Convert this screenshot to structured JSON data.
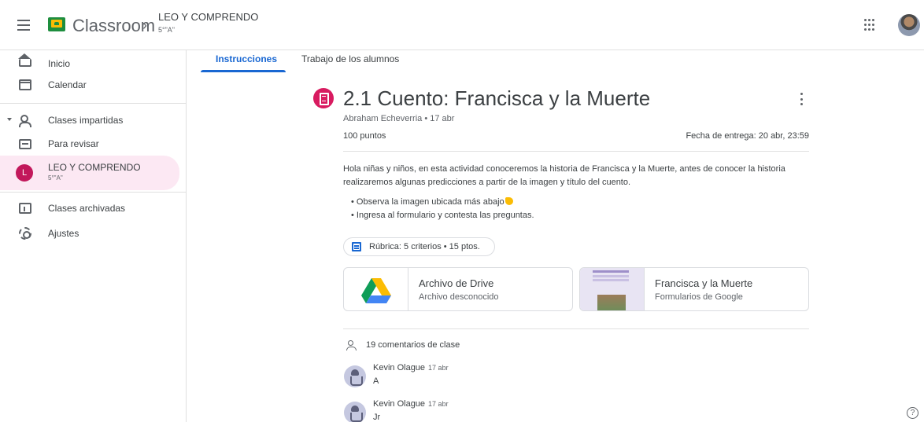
{
  "header": {
    "app_title": "Classroom",
    "separator": "›",
    "class_name": "LEO Y COMPRENDO",
    "class_section": "5°\"A\""
  },
  "sidebar": {
    "items": [
      {
        "label": "Inicio",
        "icon": "home-icon"
      },
      {
        "label": "Calendar",
        "icon": "calendar-icon"
      },
      {
        "label": "Clases impartidas",
        "icon": "people-icon"
      },
      {
        "label": "Para revisar",
        "icon": "inbox-icon"
      },
      {
        "label": "LEO Y COMPRENDO",
        "sub": "5°\"A\"",
        "avatar_letter": "L",
        "active": true
      },
      {
        "label": "Clases archivadas",
        "icon": "archive-icon"
      },
      {
        "label": "Ajustes",
        "icon": "gear-icon"
      }
    ]
  },
  "tabs": [
    {
      "label": "Instrucciones",
      "active": true
    },
    {
      "label": "Trabajo de los alumnos",
      "active": false
    }
  ],
  "assignment": {
    "title": "2.1 Cuento: Francisca y la Muerte",
    "meta": "Abraham Echeverria • 17 abr",
    "points": "100 puntos",
    "due": "Fecha de entrega: 20 abr, 23:59",
    "description": "Hola niñas y niños, en esta actividad conoceremos la historia de Francisca y la Muerte, antes de conocer la historia realizaremos algunas predicciones a partir de la imagen y título del cuento.",
    "bullets": [
      "Observa la imagen ubicada más abajo",
      "Ingresa al formulario y contesta las preguntas."
    ],
    "rubric": "Rúbrica: 5 criterios • 15 ptos.",
    "attachments": [
      {
        "title": "Archivo de Drive",
        "subtitle": "Archivo desconocido"
      },
      {
        "title": "Francisca y la Muerte",
        "subtitle": "Formularios de Google"
      }
    ]
  },
  "comments": {
    "header": "19 comentarios de clase",
    "items": [
      {
        "author": "Kevin Olague",
        "date": "17 abr",
        "text": "A"
      },
      {
        "author": "Kevin Olague",
        "date": "17 abr",
        "text": "Jr"
      }
    ]
  },
  "colors": {
    "accent_blue": "#1967d2",
    "class_pink": "#c2185b",
    "assignment_pink": "#d81b60",
    "active_bg": "#fce8f3"
  }
}
